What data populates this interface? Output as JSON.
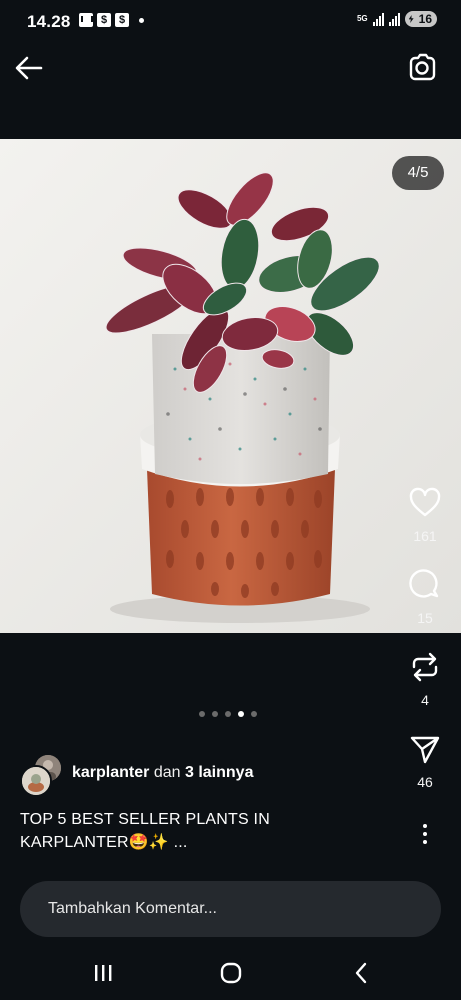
{
  "status_bar": {
    "time": "14.28",
    "network": "5G",
    "battery": "16"
  },
  "post": {
    "page_counter": "4/5",
    "current_page": 4,
    "total_pages": 5,
    "likes": "161",
    "comments": "15",
    "reposts": "4",
    "shares": "46",
    "author": "karplanter",
    "author_connector": "dan",
    "others": "3 lainnya",
    "caption": "TOP 5 BEST SELLER PLANTS IN KARPLANTER🤩✨ ..."
  },
  "comment_input": {
    "placeholder": "Tambahkan Komentar..."
  },
  "icons": {
    "back": "arrow-left-icon",
    "camera": "camera-icon",
    "like": "heart-icon",
    "comment": "comment-bubble-icon",
    "repost": "repost-icon",
    "share": "send-icon",
    "more": "more-vertical-icon",
    "nav_recents": "recents-icon",
    "nav_home": "home-icon",
    "nav_back": "nav-back-icon"
  },
  "colors": {
    "background": "#0c1014",
    "input_bg": "#25292e",
    "pot_terracotta": "#b95a39"
  }
}
